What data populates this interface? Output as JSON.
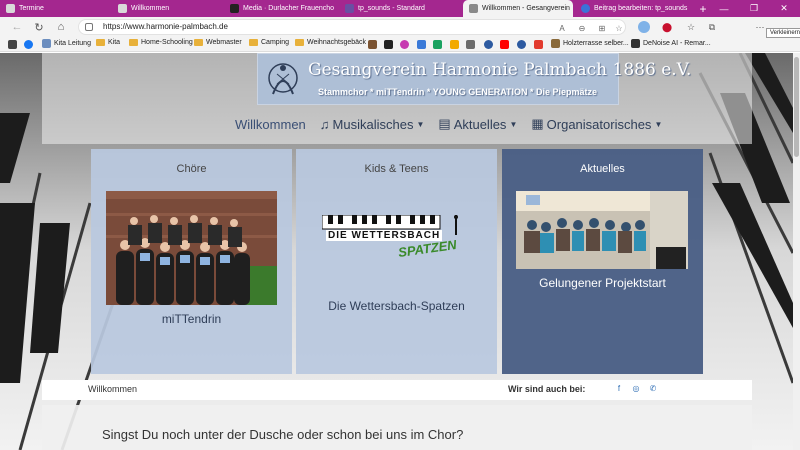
{
  "browser": {
    "tabs": [
      {
        "title": "Termine",
        "color": "#d9d9d9",
        "active": false
      },
      {
        "title": "Willkommen",
        "color": "#d9d9d9",
        "active": false
      },
      {
        "title": "Media · Durlacher Frauencho",
        "color": "#222222",
        "active": false
      },
      {
        "title": "tp_sounds - Standard",
        "color": "#6a4fa3",
        "active": false
      },
      {
        "title": "Willkommen - Gesangverein",
        "color": "#8a8a8a",
        "active": true
      },
      {
        "title": "Beitrag bearbeiten: tp_sounds",
        "color": "#3b73d8",
        "active": false
      }
    ],
    "new_tab": "+",
    "address": "https://www.harmonie-palmbach.de",
    "window_buttons": [
      "—",
      "❐",
      "✕"
    ],
    "tooltip": "Verkleinern",
    "bookmarks": [
      {
        "label": "",
        "type": "app"
      },
      {
        "label": "",
        "type": "facebook"
      },
      {
        "label": "Kita Leitung",
        "type": "page"
      },
      {
        "label": "Kita",
        "type": "folder"
      },
      {
        "label": "Home-Schooling",
        "type": "folder"
      },
      {
        "label": "Webmaster",
        "type": "folder"
      },
      {
        "label": "Camping",
        "type": "folder"
      },
      {
        "label": "Weihnachtsgebäck",
        "type": "folder"
      },
      {
        "label": "Holzterrasse selber...",
        "type": "page"
      },
      {
        "label": "DeNoise AI - Remar...",
        "type": "page"
      }
    ]
  },
  "site": {
    "logo_title": "Gesangverein Harmonie Palmbach 1886 e.V.",
    "logo_subtitle": "Stammchor * miTTendrin * YOUNG GENERATION * Die Piepmätze",
    "nav": [
      {
        "label": "Willkommen",
        "icon": "",
        "dropdown": false
      },
      {
        "label": "Musikalisches",
        "icon": "music-icon",
        "dropdown": true
      },
      {
        "label": "Aktuelles",
        "icon": "newspaper-icon",
        "dropdown": true
      },
      {
        "label": "Organisatorisches",
        "icon": "clipboard-icon",
        "dropdown": true
      }
    ],
    "cards": [
      {
        "heading": "Chöre",
        "caption": "miTTendrin",
        "bg": "#b9c8df"
      },
      {
        "heading": "Kids & Teens",
        "caption": "Die Wettersbach-Spatzen",
        "logo_text": "DIE WETTERSBACH",
        "logo_script": "SPATZEN",
        "bg": "#b9c8df"
      },
      {
        "heading": "Aktuelles",
        "caption": "Gelungener Projektstart",
        "bg": "#4a5f85"
      }
    ],
    "breadcrumb": "Willkommen",
    "follow_label": "Wir sind auch bei:",
    "question": "Singst Du noch unter der Dusche oder schon bei uns im Chor?"
  }
}
